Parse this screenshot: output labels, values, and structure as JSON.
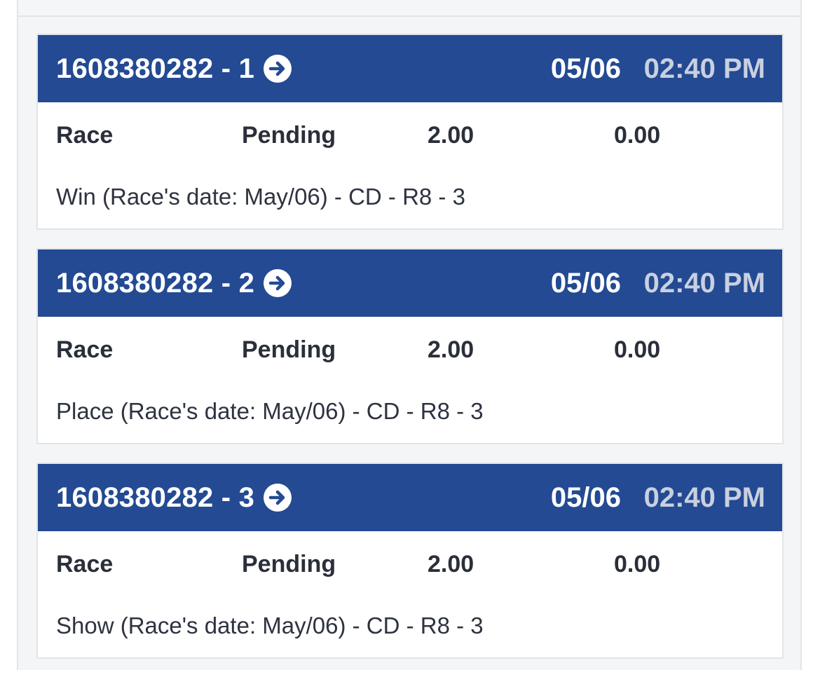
{
  "tickets": [
    {
      "id": "1608380282 - 1",
      "date": "05/06",
      "time": "02:40 PM",
      "type": "Race",
      "status": "Pending",
      "amount": "2.00",
      "payout": "0.00",
      "description": "Win (Race's date: May/06) - CD - R8 - 3"
    },
    {
      "id": "1608380282 - 2",
      "date": "05/06",
      "time": "02:40 PM",
      "type": "Race",
      "status": "Pending",
      "amount": "2.00",
      "payout": "0.00",
      "description": "Place (Race's date: May/06) - CD - R8 - 3"
    },
    {
      "id": "1608380282 - 3",
      "date": "05/06",
      "time": "02:40 PM",
      "type": "Race",
      "status": "Pending",
      "amount": "2.00",
      "payout": "0.00",
      "description": "Show (Race's date: May/06) - CD - R8 - 3"
    }
  ],
  "colors": {
    "header_bg": "#234a93",
    "time_text": "#c9d0df",
    "page_bg": "#f4f5f7",
    "border": "#e2e4e8"
  },
  "icons": {
    "ticket_arrow": "arrow-circle-right-icon"
  }
}
